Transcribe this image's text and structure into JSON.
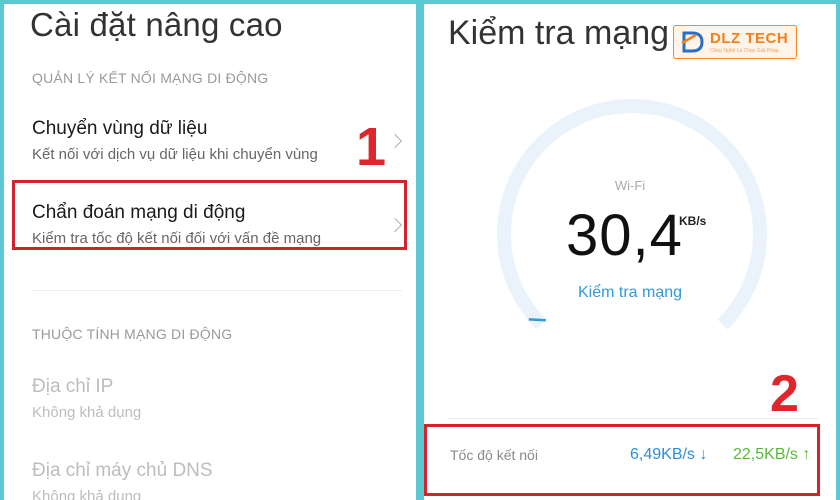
{
  "left": {
    "title": "Cài đặt nâng cao",
    "section1_header": "QUẢN LÝ KẾT NỐI MẠNG DI ĐỘNG",
    "items": [
      {
        "title": "Chuyển vùng dữ liệu",
        "subtitle": "Kết nối với dịch vụ dữ liệu khi chuyển vùng"
      },
      {
        "title": "Chẩn đoán mạng di động",
        "subtitle": "Kiểm tra tốc độ kết nối đối với vấn đề mạng"
      }
    ],
    "section2_header": "THUỘC TÍNH MẠNG DI ĐỘNG",
    "properties": [
      {
        "title": "Địa chỉ IP",
        "subtitle": "Không khả dụng"
      },
      {
        "title": "Địa chỉ máy chủ DNS",
        "subtitle": "Không khả dụng"
      }
    ],
    "annotation": "1"
  },
  "right": {
    "title": "Kiểm tra mạng",
    "logo": {
      "text": "DLZ TECH",
      "tagline": "Công Nghệ Là Chạy Giải Pháp"
    },
    "network_type": "Wi-Fi",
    "speed_value": "30,4",
    "speed_unit": "KB/s",
    "gauge_level": 0.02,
    "check_link": "Kiểm tra mạng",
    "connection_label": "Tốc độ kết nối",
    "download_speed": "6,49KB/s ↓",
    "upload_speed": "22,5KB/s ↑",
    "annotation": "2"
  },
  "colors": {
    "frame": "#5bc8d2",
    "highlight_box": "#d2232a",
    "annotation": "#e0262d",
    "accent_blue": "#2e9ad8",
    "upload_green": "#58b83c",
    "gauge_track": "#eaf3fb"
  }
}
